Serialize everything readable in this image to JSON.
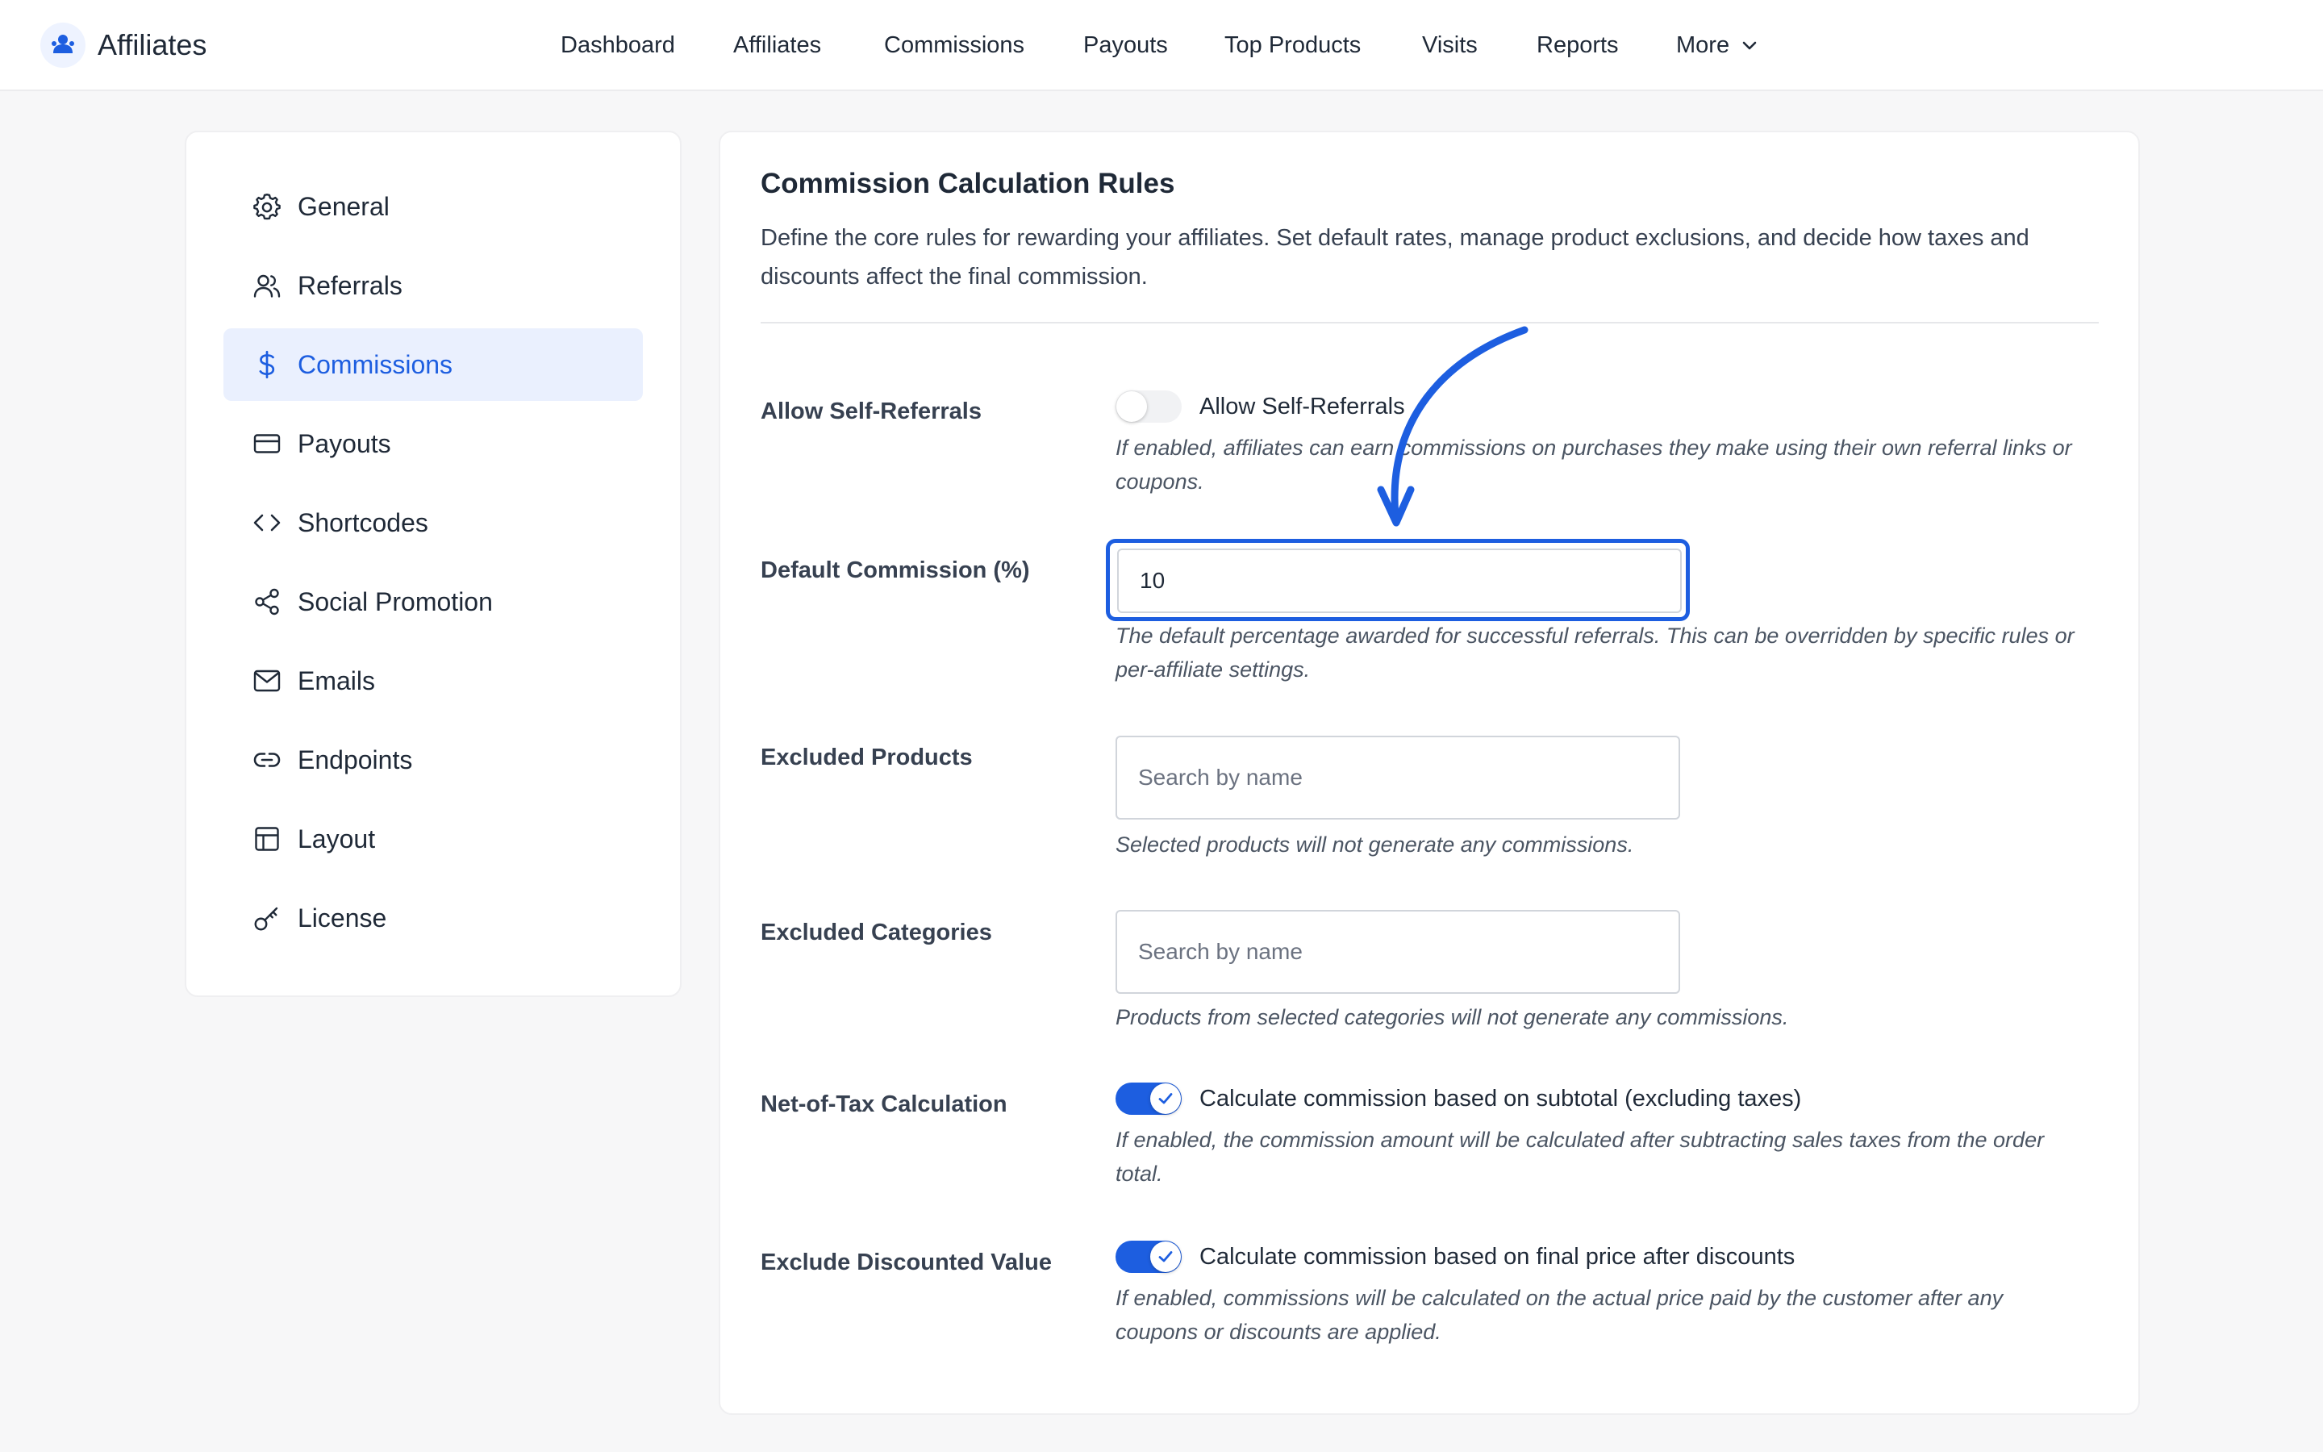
{
  "app": {
    "name": "Affiliates"
  },
  "nav": {
    "items": [
      {
        "label": "Dashboard"
      },
      {
        "label": "Affiliates"
      },
      {
        "label": "Commissions"
      },
      {
        "label": "Payouts"
      },
      {
        "label": "Top Products"
      },
      {
        "label": "Visits"
      },
      {
        "label": "Reports"
      },
      {
        "label": "More"
      }
    ]
  },
  "sidebar": {
    "items": [
      {
        "label": "General",
        "icon": "gear-icon"
      },
      {
        "label": "Referrals",
        "icon": "users-icon"
      },
      {
        "label": "Commissions",
        "icon": "dollar-icon",
        "active": true
      },
      {
        "label": "Payouts",
        "icon": "credit-card-icon"
      },
      {
        "label": "Shortcodes",
        "icon": "code-icon"
      },
      {
        "label": "Social Promotion",
        "icon": "share-icon"
      },
      {
        "label": "Emails",
        "icon": "mail-icon"
      },
      {
        "label": "Endpoints",
        "icon": "link-icon"
      },
      {
        "label": "Layout",
        "icon": "layout-icon"
      },
      {
        "label": "License",
        "icon": "key-icon"
      }
    ]
  },
  "main": {
    "title": "Commission Calculation Rules",
    "description": "Define the core rules for rewarding your affiliates. Set default rates, manage product exclusions, and decide how taxes and discounts affect the final commission.",
    "self_referrals": {
      "label": "Allow Self-Referrals",
      "toggle_label": "Allow Self-Referrals",
      "enabled": false,
      "help": "If enabled, affiliates can earn commissions on purchases they make using their own referral links or coupons."
    },
    "default_commission": {
      "label": "Default Commission (%)",
      "value": "10",
      "help": "The default percentage awarded for successful referrals. This can be overridden by specific rules or per-affiliate settings."
    },
    "excluded_products": {
      "label": "Excluded Products",
      "placeholder": "Search by name",
      "help": "Selected products will not generate any commissions."
    },
    "excluded_categories": {
      "label": "Excluded Categories",
      "placeholder": "Search by name",
      "help": "Products from selected categories will not generate any commissions."
    },
    "net_of_tax": {
      "label": "Net-of-Tax Calculation",
      "toggle_label": "Calculate commission based on subtotal (excluding taxes)",
      "enabled": true,
      "help": "If enabled, the commission amount will be calculated after subtracting sales taxes from the order total."
    },
    "exclude_discounted": {
      "label": "Exclude Discounted Value",
      "toggle_label": "Calculate commission based on final price after discounts",
      "enabled": true,
      "help": "If enabled, commissions will be calculated on the actual price paid by the customer after any coupons or discounts are applied."
    }
  },
  "colors": {
    "accent": "#1d5ee0",
    "active_bg": "#eaf0fe",
    "page_bg": "#f7f7f8"
  }
}
